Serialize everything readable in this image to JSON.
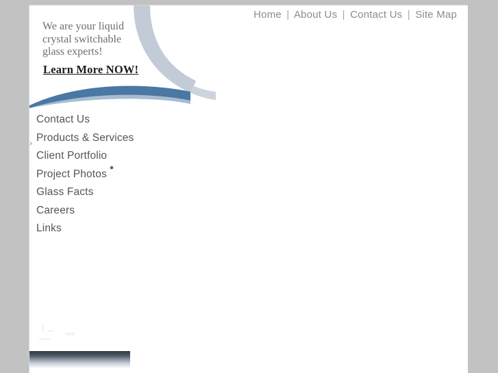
{
  "site": {
    "background_color": "#c2c2c2",
    "page_color": "#ffffff",
    "accent_blue": "#4a77a3",
    "accent_light_blue": "#c3ccd6"
  },
  "topnav": {
    "separator": "|",
    "items": [
      {
        "label": "Home"
      },
      {
        "label": "About Us"
      },
      {
        "label": "Contact Us"
      },
      {
        "label": "Site Map"
      }
    ]
  },
  "hero": {
    "tagline_lines": [
      "We are your liquid",
      "crystal switchable",
      "glass experts!"
    ],
    "cta_label": "Learn More NOW!"
  },
  "gutter": {
    "marker": "›"
  },
  "sidenav": {
    "items": [
      {
        "label": "Contact Us"
      },
      {
        "label": "Products & Services"
      },
      {
        "label": "Client Portfolio"
      },
      {
        "label": "Project Photos"
      },
      {
        "label": "Glass Facts"
      },
      {
        "label": "Careers"
      },
      {
        "label": "Links"
      }
    ]
  }
}
